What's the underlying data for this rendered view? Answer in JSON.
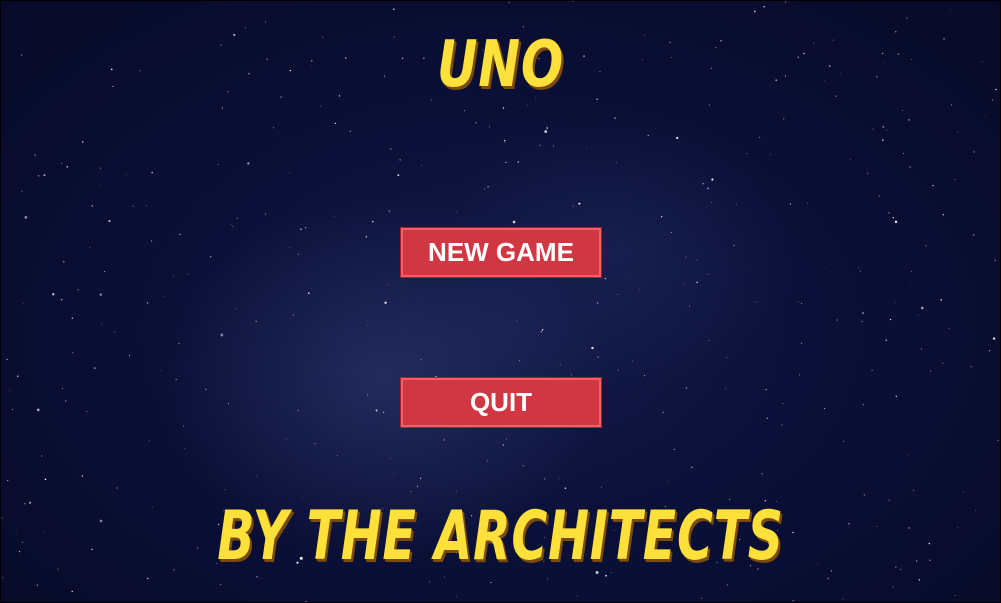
{
  "title": "UNO",
  "menu": {
    "new_game_label": "NEW GAME",
    "quit_label": "QUIT"
  },
  "credits": "BY THE ARCHITECTS",
  "colors": {
    "background": "#0a0f33",
    "title": "#fde13a",
    "title_shadow": "#7a4a10",
    "button_fill": "#d13743",
    "button_border": "#f0606a",
    "button_text": "#ffffff"
  }
}
